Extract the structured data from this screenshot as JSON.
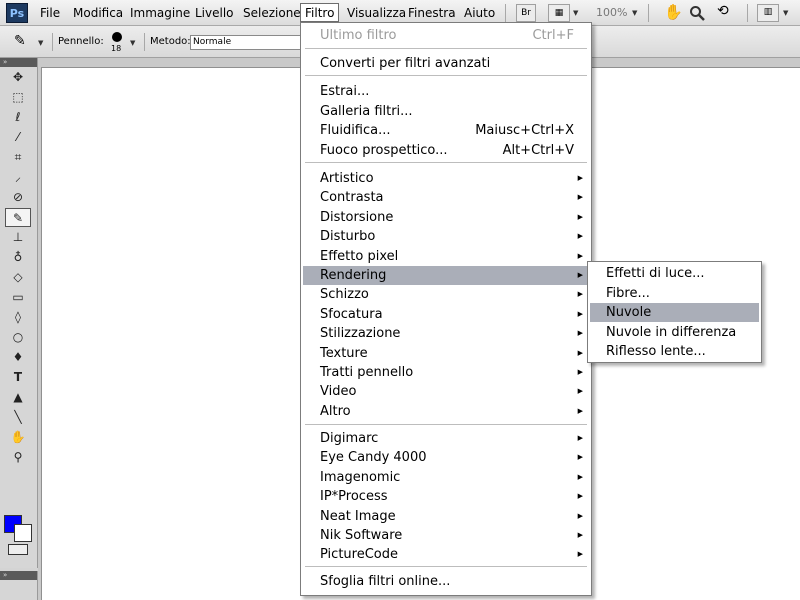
{
  "app": {
    "logo": "Ps"
  },
  "menubar": {
    "items": [
      "File",
      "Modifica",
      "Immagine",
      "Livello",
      "Selezione",
      "Filtro",
      "Visualizza",
      "Finestra",
      "Aiuto"
    ],
    "bridge_label": "Br",
    "zoom": "100%"
  },
  "options": {
    "brush_label": "Pennello:",
    "brush_size": "18",
    "mode_label": "Metodo:",
    "mode_value": "Normale"
  },
  "colors": {
    "foreground": "#0000ff",
    "background": "#ffffff",
    "highlight": "#aaaeb8"
  },
  "filter_menu": {
    "last_filter": {
      "label": "Ultimo filtro",
      "shortcut": "Ctrl+F",
      "disabled": true
    },
    "convert": "Converti per filtri avanzati",
    "items_a": [
      {
        "label": "Estrai...",
        "shortcut": ""
      },
      {
        "label": "Galleria filtri...",
        "shortcut": ""
      },
      {
        "label": "Fluidifica...",
        "shortcut": "Maiusc+Ctrl+X"
      },
      {
        "label": "Fuoco prospettico...",
        "shortcut": "Alt+Ctrl+V"
      }
    ],
    "groups_b": [
      "Artistico",
      "Contrasta",
      "Distorsione",
      "Disturbo",
      "Effetto pixel",
      "Rendering",
      "Schizzo",
      "Sfocatura",
      "Stilizzazione",
      "Texture",
      "Tratti pennello",
      "Video",
      "Altro"
    ],
    "groups_c": [
      "Digimarc",
      "Eye Candy 4000",
      "Imagenomic",
      "IP*Process",
      "Neat Image",
      "Nik Software",
      "PictureCode"
    ],
    "browse": "Sfoglia filtri online..."
  },
  "rendering_submenu": {
    "items": [
      "Effetti di luce...",
      "Fibre...",
      "Nuvole",
      "Nuvole in differenza",
      "Riflesso lente..."
    ]
  }
}
